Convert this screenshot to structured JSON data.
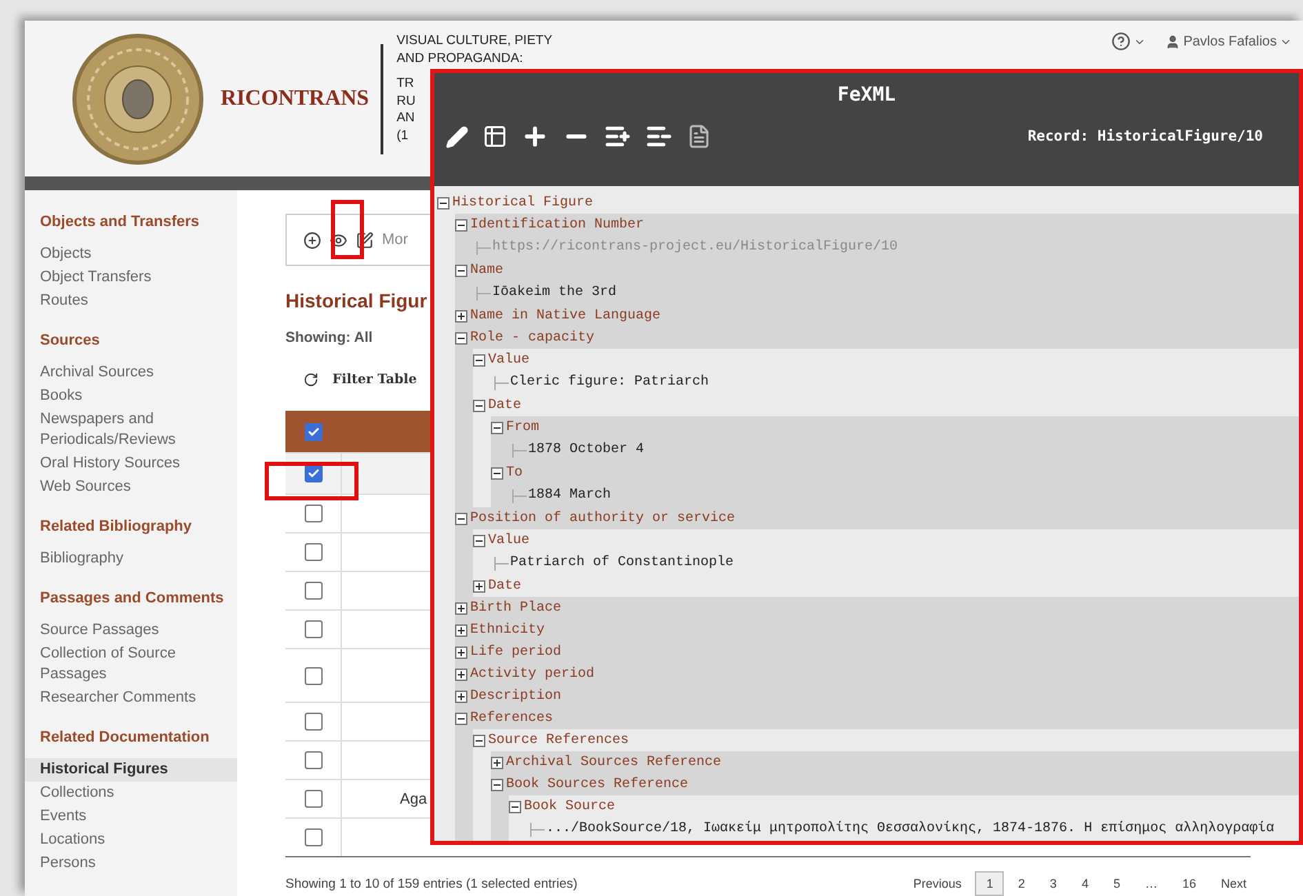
{
  "header": {
    "logo_text": "RICONTRANS",
    "subtitle_lines": [
      "VISUAL CULTURE, PIETY",
      "AND PROPAGANDA:",
      "TR",
      "RU",
      "AN",
      "(1"
    ],
    "user": "Pavlos Fafalios"
  },
  "sidebar": [
    {
      "heading": "Objects and Transfers",
      "items": [
        {
          "label": "Objects",
          "selected": false
        },
        {
          "label": "Object Transfers",
          "selected": false
        },
        {
          "label": "Routes",
          "selected": false
        }
      ]
    },
    {
      "heading": "Sources",
      "items": [
        {
          "label": "Archival Sources",
          "selected": false
        },
        {
          "label": "Books",
          "selected": false
        },
        {
          "label": "Newspapers and Periodicals/Reviews",
          "selected": false
        },
        {
          "label": "Oral History Sources",
          "selected": false
        },
        {
          "label": "Web Sources",
          "selected": false
        }
      ]
    },
    {
      "heading": "Related Bibliography",
      "items": [
        {
          "label": "Bibliography",
          "selected": false
        }
      ]
    },
    {
      "heading": "Passages and Comments",
      "items": [
        {
          "label": "Source Passages",
          "selected": false
        },
        {
          "label": "Collection of Source Passages",
          "selected": false
        },
        {
          "label": "Researcher Comments",
          "selected": false
        }
      ]
    },
    {
      "heading": "Related Documentation",
      "items": [
        {
          "label": "Historical Figures",
          "selected": true
        },
        {
          "label": "Collections",
          "selected": false
        },
        {
          "label": "Events",
          "selected": false
        },
        {
          "label": "Locations",
          "selected": false
        },
        {
          "label": "Persons",
          "selected": false
        }
      ]
    }
  ],
  "main": {
    "toolbar_more": "Mor",
    "title": "Historical Figur",
    "showing": "Showing: All",
    "filter_label": "Filter Table",
    "table": {
      "header_checked": true,
      "rows": [
        {
          "checked": true,
          "selected": true
        },
        {
          "checked": false,
          "selected": false
        },
        {
          "checked": false,
          "selected": false
        },
        {
          "checked": false,
          "selected": false
        },
        {
          "checked": false,
          "selected": false
        },
        {
          "checked": false,
          "selected": false
        },
        {
          "checked": false,
          "selected": false
        },
        {
          "checked": false,
          "selected": false
        },
        {
          "checked": false,
          "selected": false,
          "column_2": "Aga"
        },
        {
          "checked": false,
          "selected": false
        }
      ]
    },
    "footer": "Showing 1 to 10 of 159 entries (1 selected entries)",
    "pagination": {
      "previous": "Previous",
      "pages": [
        {
          "label": "1",
          "selected": true
        },
        {
          "label": "2",
          "selected": false
        },
        {
          "label": "3",
          "selected": false
        },
        {
          "label": "4",
          "selected": false
        },
        {
          "label": "5",
          "selected": false
        },
        {
          "label": "…",
          "selected": false
        },
        {
          "label": "16",
          "selected": false
        }
      ],
      "next": "Next"
    }
  },
  "fexml": {
    "title": "FeXML",
    "record": "Record: HistoricalFigure/10",
    "tree": {
      "kind": "element",
      "label": "Historical Figure",
      "expanded": true,
      "children": [
        {
          "kind": "element",
          "label": "Identification Number",
          "expanded": true,
          "children": [
            {
              "kind": "uri",
              "text": "https://ricontrans-project.eu/HistoricalFigure/10"
            }
          ]
        },
        {
          "kind": "element",
          "label": "Name",
          "expanded": true,
          "children": [
            {
              "kind": "value",
              "text": "Iōakeim the 3rd"
            }
          ]
        },
        {
          "kind": "element",
          "label": "Name in Native Language",
          "expanded": false
        },
        {
          "kind": "element",
          "label": "Role - capacity",
          "expanded": true,
          "children": [
            {
              "kind": "element",
              "label": "Value",
              "expanded": true,
              "children": [
                {
                  "kind": "value",
                  "text": "Cleric figure: Patriarch"
                }
              ]
            },
            {
              "kind": "element",
              "label": "Date",
              "expanded": true,
              "children": [
                {
                  "kind": "element",
                  "label": "From",
                  "expanded": true,
                  "children": [
                    {
                      "kind": "value",
                      "text": "1878 October 4"
                    }
                  ]
                },
                {
                  "kind": "element",
                  "label": "To",
                  "expanded": true,
                  "children": [
                    {
                      "kind": "value",
                      "text": "1884 March"
                    }
                  ]
                }
              ]
            }
          ]
        },
        {
          "kind": "element",
          "label": "Position of authority or service",
          "expanded": true,
          "children": [
            {
              "kind": "element",
              "label": "Value",
              "expanded": true,
              "children": [
                {
                  "kind": "value",
                  "text": "Patriarch of Constantinople"
                }
              ]
            },
            {
              "kind": "element",
              "label": "Date",
              "expanded": false
            }
          ]
        },
        {
          "kind": "element",
          "label": "Birth Place",
          "expanded": false
        },
        {
          "kind": "element",
          "label": "Ethnicity",
          "expanded": false
        },
        {
          "kind": "element",
          "label": "Life period",
          "expanded": false
        },
        {
          "kind": "element",
          "label": "Activity period",
          "expanded": false
        },
        {
          "kind": "element",
          "label": "Description",
          "expanded": false
        },
        {
          "kind": "element",
          "label": "References",
          "expanded": true,
          "children": [
            {
              "kind": "element",
              "label": "Source References",
              "expanded": true,
              "children": [
                {
                  "kind": "element",
                  "label": "Archival Sources Reference",
                  "expanded": false
                },
                {
                  "kind": "element",
                  "label": "Book Sources Reference",
                  "expanded": true,
                  "children": [
                    {
                      "kind": "element",
                      "label": "Book Source",
                      "expanded": true,
                      "children": [
                        {
                          "kind": "value",
                          "text": ".../BookSource/18, Ιωακείμ μητροπολίτης Θεσσαλονίκης, 1874-1876. Η επίσημος αλληλογραφία"
                        }
                      ]
                    }
                  ]
                }
              ]
            }
          ]
        }
      ]
    }
  }
}
